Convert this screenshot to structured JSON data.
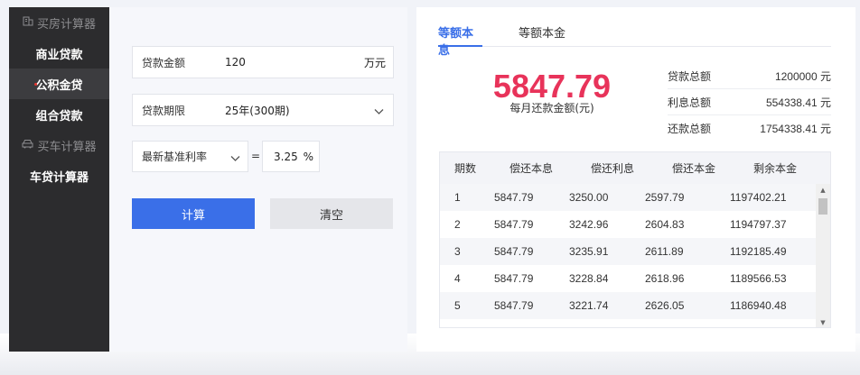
{
  "sidebar": {
    "house_heading": "买房计算器",
    "items": [
      {
        "label": "商业贷款"
      },
      {
        "label": "公积金贷"
      },
      {
        "label": "组合贷款"
      }
    ],
    "car_heading": "买车计算器",
    "car_items": [
      {
        "label": "车贷计算器"
      }
    ]
  },
  "form": {
    "amount": {
      "label": "贷款金额",
      "value": "120",
      "unit": "万元"
    },
    "term": {
      "label": "贷款期限",
      "value": "25年(300期)"
    },
    "rate": {
      "select": "最新基准利率",
      "equals": "=",
      "value": "3.25",
      "unit": "%"
    },
    "calc_button": "计算",
    "clear_button": "清空"
  },
  "tabs": [
    {
      "label": "等额本息",
      "active": true
    },
    {
      "label": "等额本金",
      "active": false
    }
  ],
  "result": {
    "monthly": "5847.79",
    "monthly_label": "每月还款金额(元)",
    "summary": [
      {
        "label": "贷款总额",
        "value": "1200000 元"
      },
      {
        "label": "利息总额",
        "value": "554338.41 元"
      },
      {
        "label": "还款总额",
        "value": "1754338.41 元"
      }
    ]
  },
  "table": {
    "headers": [
      "期数",
      "偿还本息",
      "偿还利息",
      "偿还本金",
      "剩余本金"
    ],
    "rows": [
      [
        "1",
        "5847.79",
        "3250.00",
        "2597.79",
        "1197402.21"
      ],
      [
        "2",
        "5847.79",
        "3242.96",
        "2604.83",
        "1194797.37"
      ],
      [
        "3",
        "5847.79",
        "3235.91",
        "2611.89",
        "1192185.49"
      ],
      [
        "4",
        "5847.79",
        "3228.84",
        "2618.96",
        "1189566.53"
      ],
      [
        "5",
        "5847.79",
        "3221.74",
        "2626.05",
        "1186940.48"
      ]
    ]
  },
  "colors": {
    "accent": "#3a6fe8",
    "highlight": "#e8335a",
    "sidebar_bg": "#2c2c2e"
  }
}
